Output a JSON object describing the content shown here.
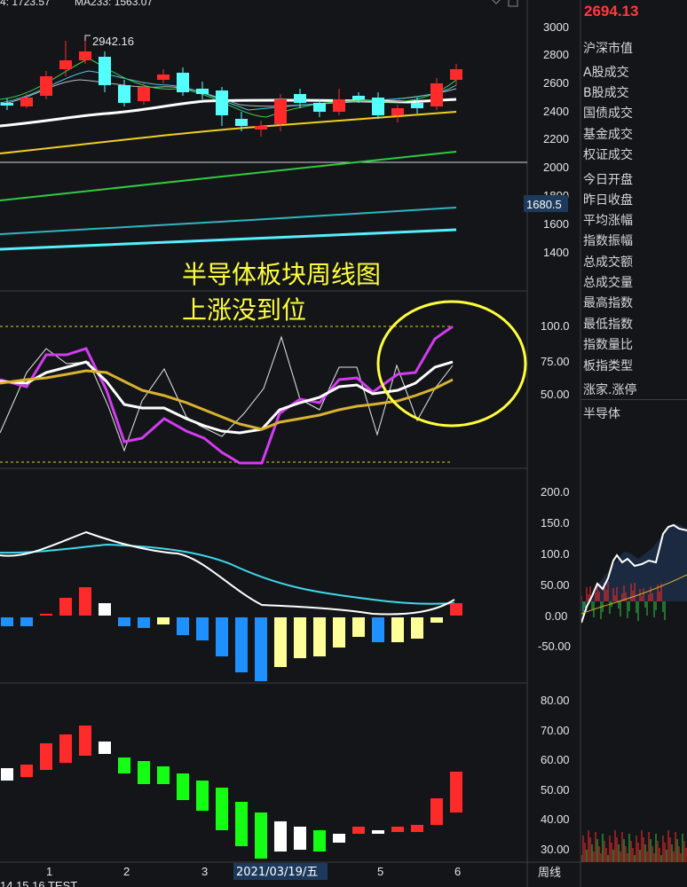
{
  "header": {
    "ma_label_1": "4: 1723.57",
    "ma_label_2": "MA233: 1563.07"
  },
  "price_pane": {
    "axis_ticks": [
      "3000",
      "2800",
      "2600",
      "2400",
      "2200",
      "2000",
      "1800",
      "1600",
      "1400"
    ],
    "peak_label": "2942.16",
    "crosshair_value": "1680.5"
  },
  "indicator_pane": {
    "axis_ticks": [
      "100.0",
      "75.00",
      "50.00"
    ]
  },
  "macd_pane": {
    "axis_ticks": [
      "200.0",
      "150.0",
      "100.0",
      "50.00",
      "0.00",
      "-50.00"
    ]
  },
  "bottom_pane": {
    "axis_ticks": [
      "80.00",
      "70.00",
      "60.00",
      "50.00",
      "40.00",
      "30.00"
    ]
  },
  "time_axis": {
    "labels": [
      "1",
      "2",
      "3",
      "2021/03/19/五",
      "5",
      "6"
    ],
    "period_label": "周线",
    "bottom_row": "14  15  16  TEST"
  },
  "annotation": {
    "line1": "半导体板块周线图",
    "line2": "上涨没到位",
    "circle_color": "#ffff3c"
  },
  "side_panel": {
    "price": "2694.13",
    "items": [
      "沪深市值",
      "A股成交",
      "B股成交",
      "国债成交",
      "基金成交",
      "权证成交",
      "今日开盘",
      "昨日收盘",
      "平均涨幅",
      "指数振幅",
      "总成交额",
      "总成交量",
      "最高指数",
      "最低指数",
      "指数量比",
      "板指类型",
      "涨家.涨停",
      "半导体"
    ]
  },
  "colors": {
    "up": "#ff2a2a",
    "down_cyan": "#54ffff",
    "magenta": "#d23cf0",
    "gold": "#d9b330",
    "green": "#2ecc40",
    "blue_bar": "#1e90ff",
    "yellow_bar": "#ffff9a",
    "bright_green": "#14ff14"
  }
}
